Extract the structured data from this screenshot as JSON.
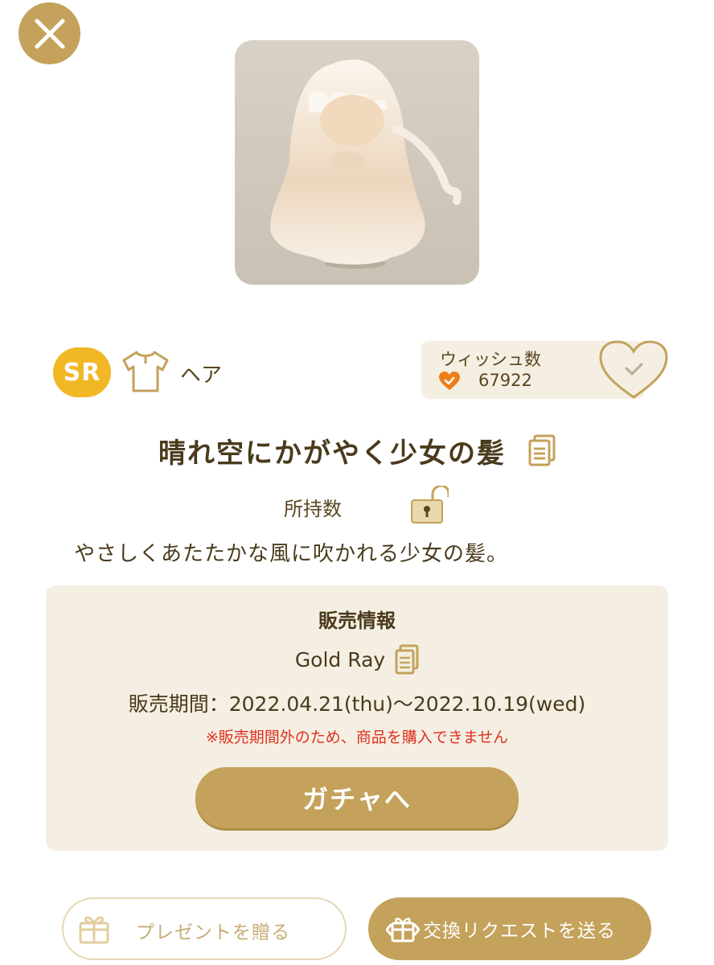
{
  "item": {
    "rarity": "SR",
    "category": "ヘア",
    "title": "晴れ空にかがやく少女の髪",
    "owned_label": "所持数",
    "description": "やさしくあたたかな風に吹かれる少女の髪。"
  },
  "wish": {
    "label": "ウィッシュ数",
    "count": "67922"
  },
  "sale": {
    "heading": "販売情報",
    "gacha_name": "Gold Ray",
    "period": "販売期間：2022.04.21(thu)〜2022.10.19(wed)",
    "warning": "※販売期間外のため、商品を購入できません",
    "gacha_button": "ガチャへ"
  },
  "actions": {
    "present_label": "プレゼントを贈る",
    "exchange_label": "交換リクエストを送る"
  },
  "colors": {
    "gold": "#c4a25b",
    "rarity_badge": "#f2b724",
    "panel": "#f4efe2",
    "warning": "#e03020",
    "wish_heart": "#ef7d1a"
  },
  "icons": [
    "close-icon",
    "shirt-icon",
    "heart-icon",
    "heart-check-icon",
    "copy-icon",
    "unlocked-padlock-icon",
    "gift-icon",
    "exchange-gift-icon"
  ]
}
